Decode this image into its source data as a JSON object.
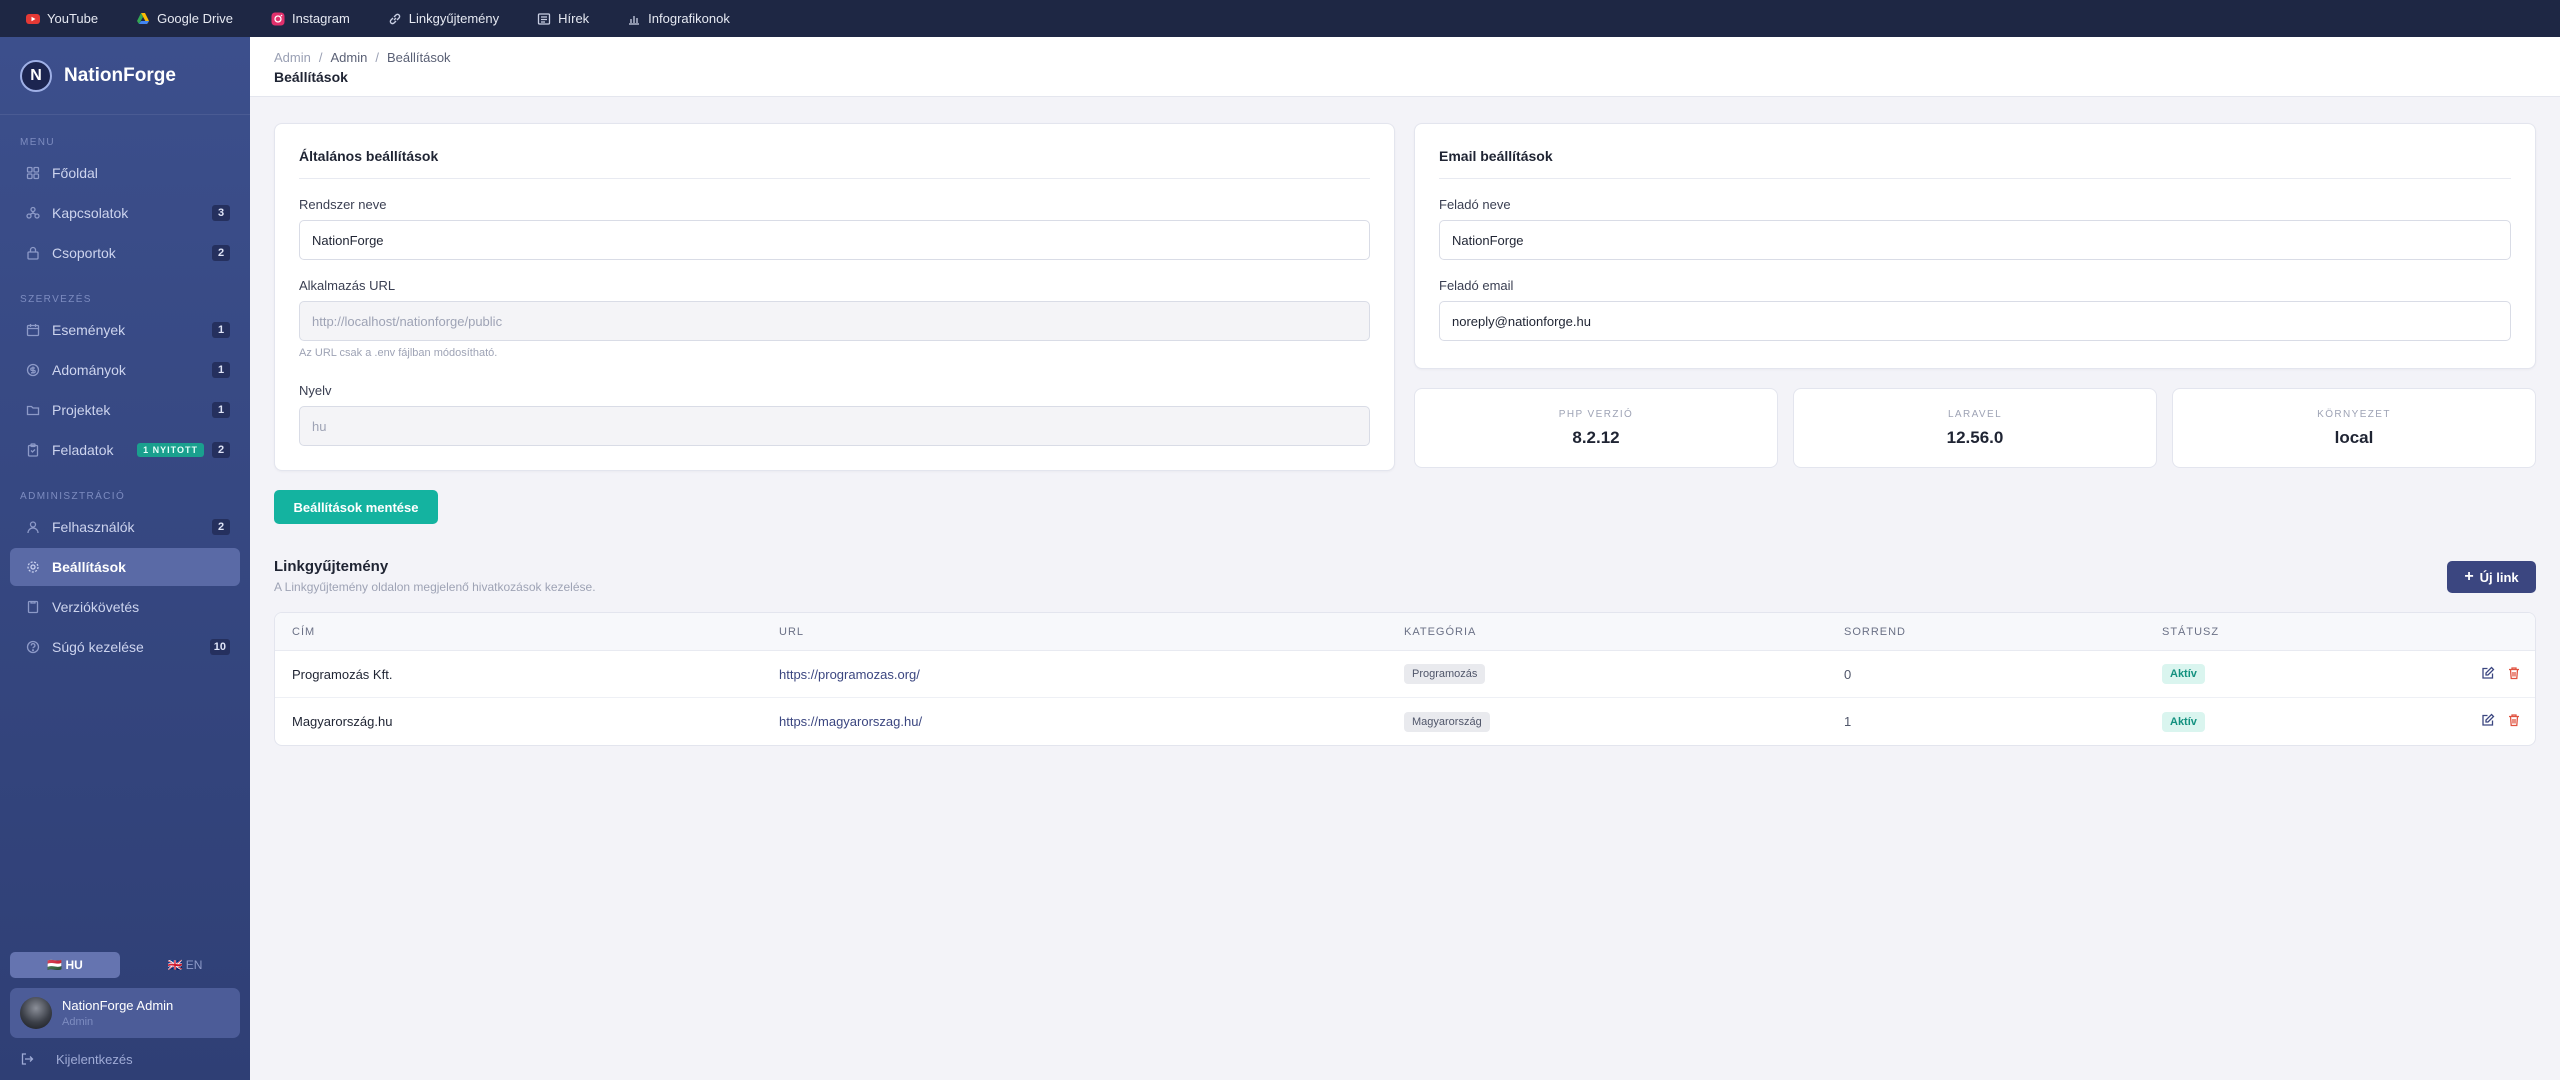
{
  "topbar": {
    "links": [
      {
        "label": "YouTube",
        "icon": "youtube-icon"
      },
      {
        "label": "Google Drive",
        "icon": "google-drive-icon"
      },
      {
        "label": "Instagram",
        "icon": "instagram-icon"
      },
      {
        "label": "Linkgyűjtemény",
        "icon": "link-icon"
      },
      {
        "label": "Hírek",
        "icon": "news-icon"
      },
      {
        "label": "Infografikonok",
        "icon": "chart-icon"
      }
    ]
  },
  "sidebar": {
    "brand": "NationForge",
    "brand_letter": "N",
    "sections": {
      "menu": "MENU",
      "org": "SZERVEZÉS",
      "admin": "ADMINISZTRÁCIÓ"
    },
    "items": [
      {
        "label": "Főoldal",
        "badge": ""
      },
      {
        "label": "Kapcsolatok",
        "badge": "3"
      },
      {
        "label": "Csoportok",
        "badge": "2"
      },
      {
        "label": "Események",
        "badge": "1"
      },
      {
        "label": "Adományok",
        "badge": "1"
      },
      {
        "label": "Projektek",
        "badge": "1"
      },
      {
        "label": "Feladatok",
        "badge": "2",
        "tag": "1 NYITOTT"
      },
      {
        "label": "Felhasználók",
        "badge": "2"
      },
      {
        "label": "Beállítások",
        "badge": ""
      },
      {
        "label": "Verziókövetés",
        "badge": ""
      },
      {
        "label": "Súgó kezelése",
        "badge": "10"
      }
    ],
    "lang_hu": "🇭🇺 HU",
    "lang_en": "🇬🇧 EN",
    "user_name": "NationForge Admin",
    "user_role": "Admin",
    "logout": "Kijelentkezés"
  },
  "header": {
    "crumb1": "Admin",
    "crumb2": "Admin",
    "crumb3": "Beállítások",
    "sep": "/",
    "title": "Beállítások"
  },
  "general": {
    "title": "Általános beállítások",
    "system_name_label": "Rendszer neve",
    "system_name_value": "NationForge",
    "app_url_label": "Alkalmazás URL",
    "app_url_value": "http://localhost/nationforge/public",
    "app_url_hint": "Az URL csak a .env fájlban módosítható.",
    "language_label": "Nyelv",
    "language_value": "hu"
  },
  "email": {
    "title": "Email beállítások",
    "sender_name_label": "Feladó neve",
    "sender_name_value": "NationForge",
    "sender_email_label": "Feladó email",
    "sender_email_value": "noreply@nationforge.hu"
  },
  "stats": [
    {
      "label": "PHP VERZIÓ",
      "value": "8.2.12"
    },
    {
      "label": "LARAVEL",
      "value": "12.56.0"
    },
    {
      "label": "KÖRNYEZET",
      "value": "local"
    }
  ],
  "save_label": "Beállítások mentése",
  "links_section": {
    "title": "Linkgyűjtemény",
    "subtitle": "A Linkgyűjtemény oldalon megjelenő hivatkozások kezelése.",
    "new_label": "Új link",
    "columns": [
      "CÍM",
      "URL",
      "KATEGÓRIA",
      "SORREND",
      "STÁTUSZ"
    ],
    "rows": [
      {
        "title": "Programozás Kft.",
        "url": "https://programozas.org/",
        "category": "Programozás",
        "order": "0",
        "status": "Aktív"
      },
      {
        "title": "Magyarország.hu",
        "url": "https://magyarorszag.hu/",
        "category": "Magyarország",
        "order": "1",
        "status": "Aktív"
      }
    ]
  },
  "colors": {
    "topbar": "#1e2744",
    "sidebar": "#3c4f8c",
    "accent": "#14b3a0",
    "primary": "#3b4680"
  }
}
